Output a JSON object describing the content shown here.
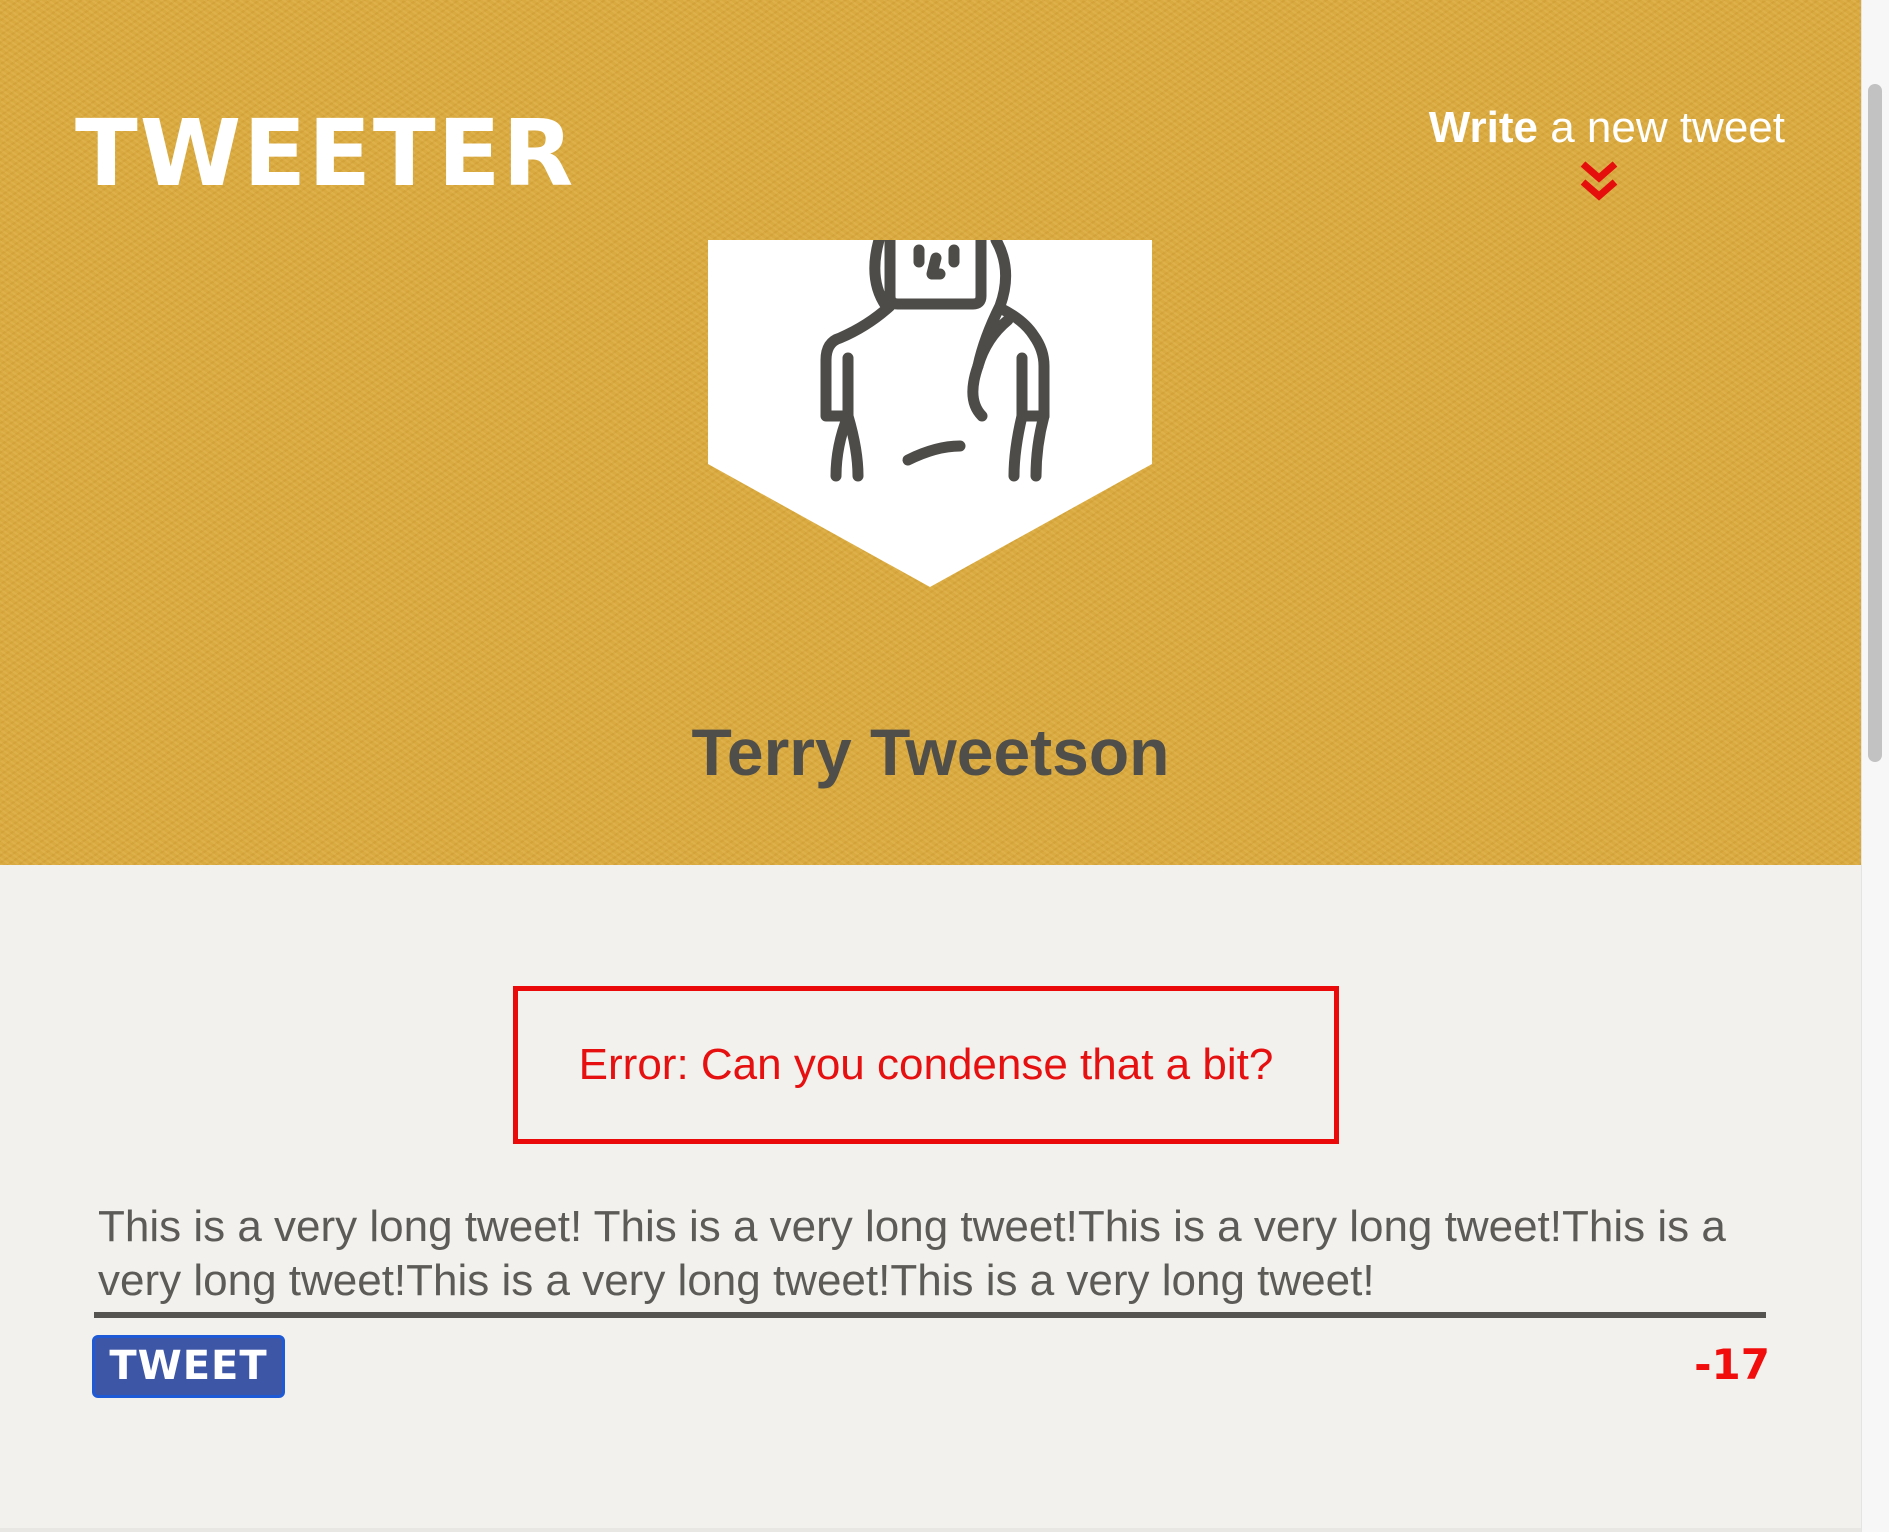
{
  "header": {
    "brand": "TWEETER",
    "compose_link": {
      "bold": "Write",
      "rest": " a new tweet"
    },
    "compose_icon": "double-chevron-down-icon"
  },
  "profile": {
    "name": "Terry Tweetson",
    "avatar_icon": "person-avatar-icon"
  },
  "composer": {
    "error_message": "Error: Can you condense that a bit?",
    "text": "This is a very long tweet! This is a very long tweet!This is a very long tweet!This is a very long tweet!This is a very long tweet!This is a very long tweet!",
    "button_label": "TWEET",
    "counter": "-17"
  },
  "colors": {
    "header_bg": "#dcaa3b",
    "page_bg": "#f2f1ed",
    "error": "#ea0a0a",
    "button_bg": "#3e56a6",
    "name_text": "#4f4e4a"
  }
}
